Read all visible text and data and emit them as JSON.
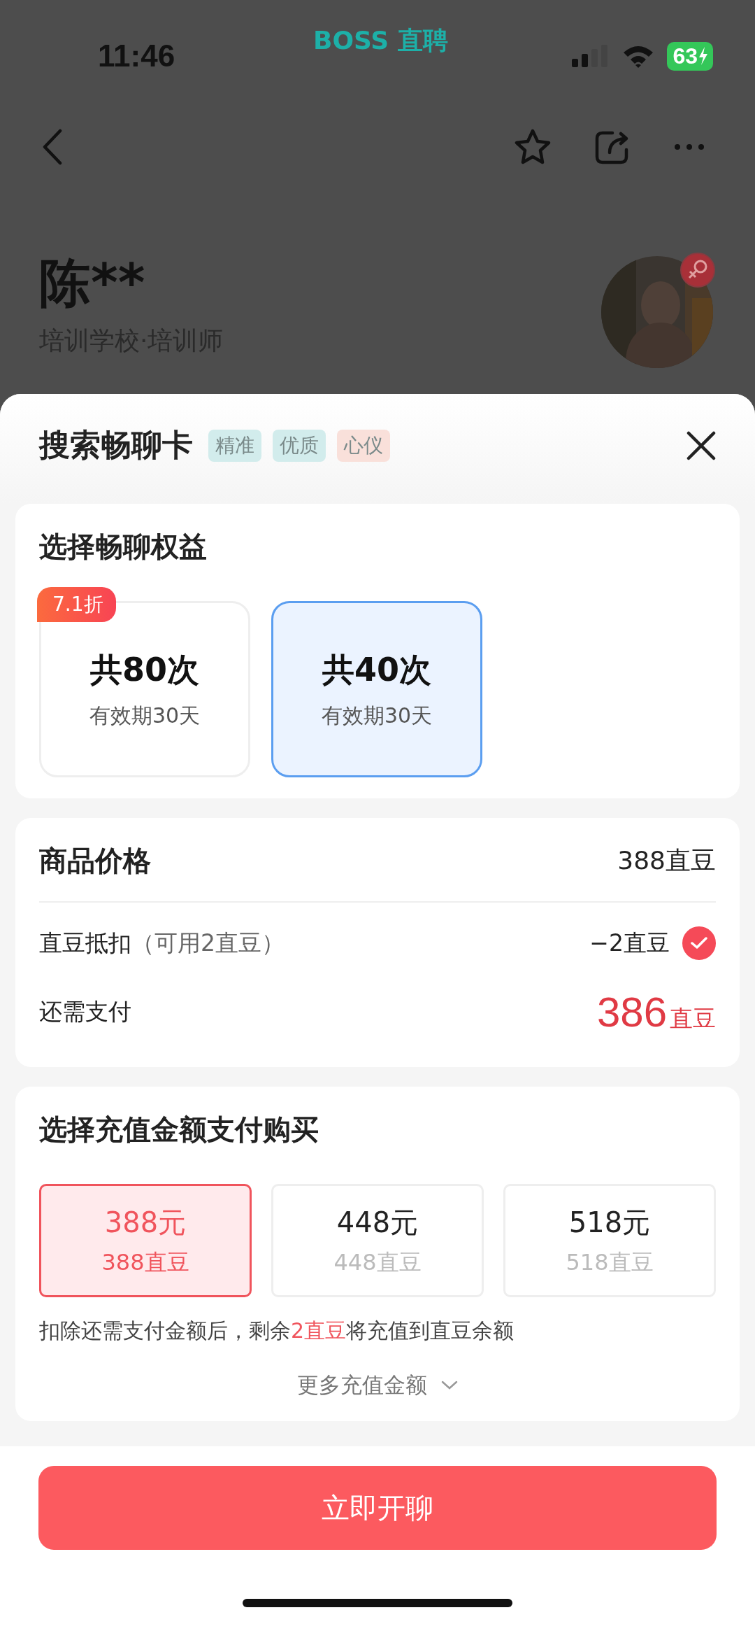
{
  "status_bar": {
    "time": "11:46",
    "app_label": "BOSS 直聘",
    "battery": "63"
  },
  "profile": {
    "name": "陈**",
    "subtitle": "培训学校·培训师"
  },
  "sheet": {
    "title": "搜索畅聊卡",
    "tags": [
      {
        "label": "精准",
        "color": "#d2ecec"
      },
      {
        "label": "优质",
        "color": "#d2ecec"
      },
      {
        "label": "心仪",
        "color": "#f9e0da"
      }
    ],
    "benefits": {
      "heading": "选择畅聊权益",
      "options": [
        {
          "badge": "7.1折",
          "count": "共80次",
          "validity": "有效期30天",
          "selected": false
        },
        {
          "count": "共40次",
          "validity": "有效期30天",
          "selected": true
        }
      ]
    },
    "price": {
      "label": "商品价格",
      "value": "388直豆",
      "deduction": {
        "label": "直豆抵扣",
        "note": "（可用2直豆）",
        "value": "−2直豆",
        "checked": true
      },
      "due": {
        "label": "还需支付",
        "amount": "386",
        "unit": "直豆"
      }
    },
    "recharge": {
      "heading": "选择充值金额支付购买",
      "options": [
        {
          "price": "388元",
          "beans": "388直豆",
          "selected": true
        },
        {
          "price": "448元",
          "beans": "448直豆",
          "selected": false
        },
        {
          "price": "518元",
          "beans": "518直豆",
          "selected": false
        }
      ],
      "note": {
        "before": "扣除还需支付金额后，剩余",
        "highlight": "2直豆",
        "after": "将充值到直豆余额"
      },
      "more": "更多充值金额"
    },
    "action": "立即开聊"
  }
}
